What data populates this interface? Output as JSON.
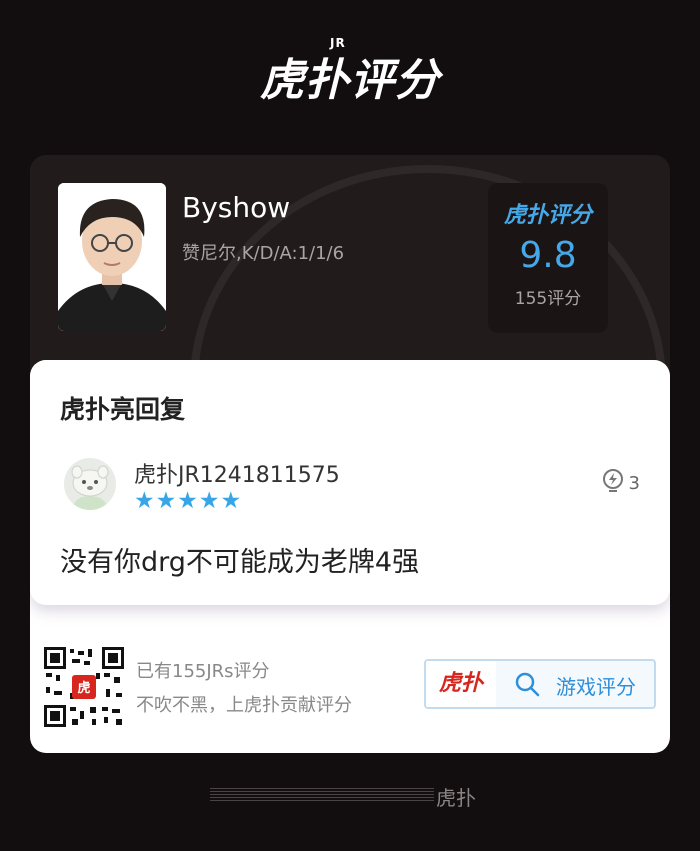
{
  "header": {
    "logo_text": "虎扑评分",
    "logo_badge": "JR"
  },
  "player": {
    "name": "Byshow",
    "detail": "赞尼尔,K/D/A:1/1/6",
    "score_logo": "虎扑评分",
    "score": "9.8",
    "rating_count": "155评分"
  },
  "reply": {
    "title": "虎扑亮回复",
    "username": "虎扑JR1241811575",
    "stars": "★★★★★",
    "rating_stars": 5,
    "likes": "3",
    "content": "没有你drg不可能成为老牌4强"
  },
  "promo": {
    "line1": "已有155JRs评分",
    "line2": "不吹不黑，上虎扑贡献评分",
    "button_logo": "虎扑",
    "button_label": "游戏评分"
  },
  "footer": {
    "text": "虎扑"
  },
  "colors": {
    "accent_blue": "#45a8e8",
    "brand_red": "#d7261e",
    "background": "#120d0e"
  }
}
